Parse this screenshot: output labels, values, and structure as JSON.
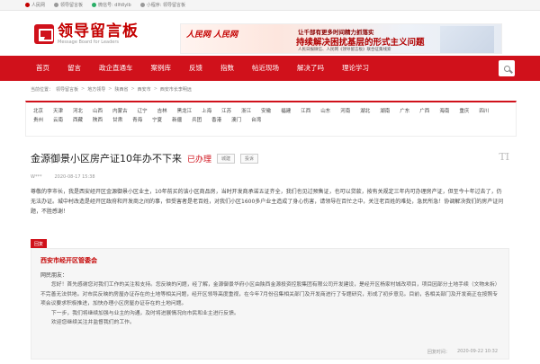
{
  "topbar": {
    "items": [
      "人民网",
      "领导留言板",
      "微信号: dlfdlylb",
      "小程序: 领导留言板"
    ]
  },
  "header": {
    "logo_title": "领导留言板",
    "logo_sub": "Message Board for Leaders",
    "banner": {
      "brand": "人民网 人民网",
      "line1": "让千部有更多时间精力抓落实",
      "line2": "持续解决困扰基层的形式主义问题",
      "line3": "人民日报微信、人民网《领导留言板》联合征集线索"
    }
  },
  "nav": {
    "items": [
      "首页",
      "留言",
      "政企直通车",
      "案例库",
      "反馈",
      "指数",
      "帖近现场",
      "解决了吗",
      "理论学习"
    ]
  },
  "breadcrumb": [
    "当前位置：",
    "领导留言板",
    ">",
    "地方领导",
    ">",
    "陕西省",
    ">",
    "西安市",
    ">",
    "西安市长李明远"
  ],
  "regions": [
    "北京",
    "天津",
    "河北",
    "山西",
    "内蒙古",
    "辽宁",
    "吉林",
    "黑龙江",
    "上海",
    "江苏",
    "浙江",
    "安徽",
    "福建",
    "江西",
    "山东",
    "河南",
    "湖北",
    "湖南",
    "广东",
    "广西",
    "海南",
    "重庆",
    "四川",
    "贵州",
    "云南",
    "西藏",
    "陕西",
    "甘肃",
    "青海",
    "宁夏",
    "新疆",
    "兵团",
    "香港",
    "澳门",
    "台湾"
  ],
  "post": {
    "title": "金源御景小区房产证10年办不下来",
    "status": "已办理",
    "tags": [
      "城建",
      "投诉"
    ],
    "author": "W***",
    "time": "2020-08-17 15:38",
    "content": "尊敬的李市长，我是西安经开区金源御景小区业主，10年前买的该小区商品房，当时开发商承诺五证齐全，我们也见过预售证，也可以贷款，按有关规定三年内可办理房产证，但至今十年过去了，仍无法办证。城中村改造是经开区政府和开发商之间的事，但受害者是老百姓，对我们小区1600多户业主造成了身心伤害，请领导在百忙之中，关注老百姓的难处，急民所急！协调解决我们的房产证问题，不胜感谢！"
  },
  "reply": {
    "tag": "回复",
    "org": "西安市经开区管委会",
    "greeting": "网民朋友：",
    "text1": "您好！首先感谢您对我们工作的关注和支持。您反映的问题，经了解，金源御景华府小区由陕西金源投资控股集团有限公司开发建设，是经开区杨家村城改项目，项目因部分土地手续（文物未拆）不完善无法供地。对市民反映的房屋办证存在的土地等相关问题，经开区领导高度重视，在今年7月份召集相关部门及开发商进行了专题研究，形成了初步意见。目前，各相关部门及开发商正在按照专项会议要求积极推进，加快办理小区房屋办证存在的土地问题。",
    "text2": "下一步，我们将继续加强与业主的沟通，及时将进展情况向市民和业主进行反馈。",
    "text3": "欢迎您继续关注并监督我们的工作。",
    "date_label": "回复时间：",
    "date": "2020-09-22 10:32"
  }
}
